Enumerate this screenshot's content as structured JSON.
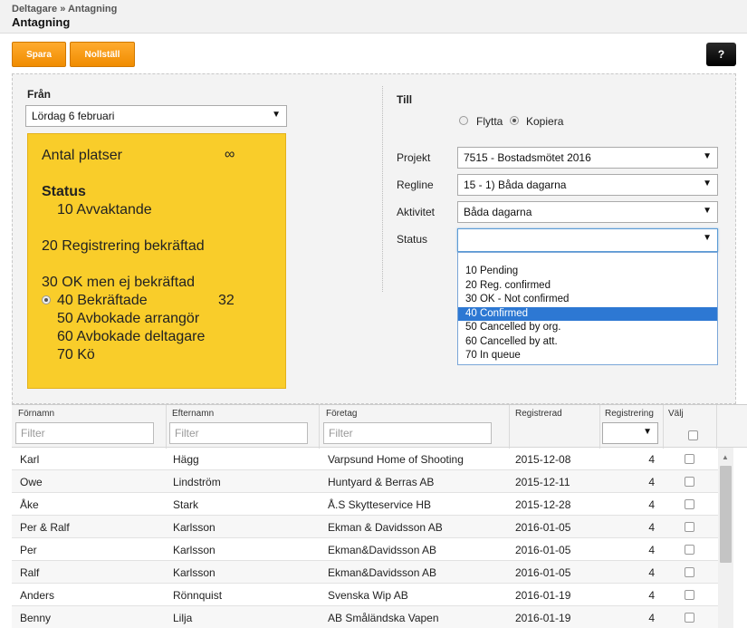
{
  "header": {
    "breadcrumb": "Deltagare » Antagning",
    "title": "Antagning"
  },
  "toolbar": {
    "save_label": "Spara",
    "reset_label": "Nollställ",
    "help_label": "?"
  },
  "from": {
    "label": "Från",
    "date_value": "Lördag 6 februari",
    "seats_label": "Antal platser",
    "seats_value": "∞",
    "status_heading": "Status",
    "statuses": [
      {
        "label": "10 Avvaktande",
        "count": ""
      },
      {
        "label": "20 Registrering bekräftad",
        "count": ""
      },
      {
        "label": "30 OK men ej bekräftad",
        "count": ""
      },
      {
        "label": "40 Bekräftade",
        "count": "32"
      },
      {
        "label": "50 Avbokade arrangör",
        "count": ""
      },
      {
        "label": "60 Avbokade deltagare",
        "count": ""
      },
      {
        "label": "70 Kö",
        "count": ""
      }
    ],
    "selected_status": "40 Bekräftade"
  },
  "to": {
    "label": "Till",
    "move_label": "Flytta",
    "copy_label": "Kopiera",
    "selected_mode": "Kopiera",
    "project_label": "Projekt",
    "project_value": "7515 - Bostadsmötet 2016",
    "regline_label": "Regline",
    "regline_value": "15 - 1) Båda dagarna",
    "activity_label": "Aktivitet",
    "activity_value": "Båda dagarna",
    "status_label": "Status",
    "status_value": "",
    "status_options": [
      "10 Pending",
      "20 Reg. confirmed",
      "30 OK - Not confirmed",
      "40 Confirmed",
      "50 Cancelled by org.",
      "60 Cancelled by att.",
      "70 In queue"
    ],
    "highlighted_option": "40 Confirmed"
  },
  "table": {
    "columns": [
      "Förnamn",
      "Efternamn",
      "Företag",
      "Registrerad",
      "Registrering",
      "Välj"
    ],
    "filter_placeholder": "Filter",
    "rows": [
      [
        "Karl",
        "Hägg",
        "Varpsund Home of Shooting",
        "2015-12-08",
        "4"
      ],
      [
        "Owe",
        "Lindström",
        "Huntyard & Berras AB",
        "2015-12-11",
        "4"
      ],
      [
        "Åke",
        "Stark",
        "Å.S Skytteservice HB",
        "2015-12-28",
        "4"
      ],
      [
        "Per & Ralf",
        "Karlsson",
        "Ekman & Davidsson AB",
        "2016-01-05",
        "4"
      ],
      [
        "Per",
        "Karlsson",
        "Ekman&Davidsson AB",
        "2016-01-05",
        "4"
      ],
      [
        "Ralf",
        "Karlsson",
        "Ekman&Davidsson AB",
        "2016-01-05",
        "4"
      ],
      [
        "Anders",
        "Rönnquist",
        "Svenska Wip AB",
        "2016-01-19",
        "4"
      ],
      [
        "Benny",
        "Lilja",
        "AB Småländska Vapen",
        "2016-01-19",
        "4"
      ]
    ]
  },
  "colors": {
    "accent_orange": "#f39200",
    "note_yellow": "#f9cd2a",
    "selection_blue": "#2d78d3"
  }
}
